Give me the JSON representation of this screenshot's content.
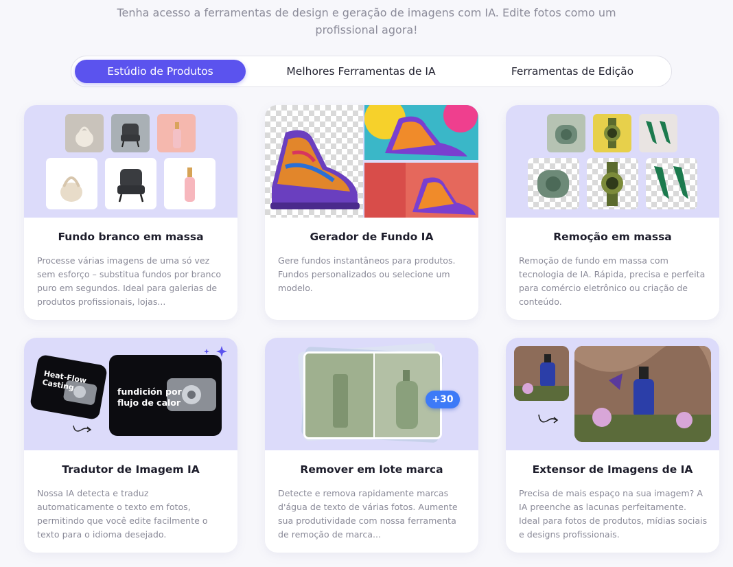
{
  "intro": {
    "line1": "Tenha acesso a ferramentas de design e geração de imagens com IA. Edite fotos como um",
    "line2": "profissional agora!"
  },
  "tabs": [
    {
      "label": "Estúdio de Produtos",
      "active": true
    },
    {
      "label": "Melhores Ferramentas de IA",
      "active": false
    },
    {
      "label": "Ferramentas de Edição",
      "active": false
    }
  ],
  "cards": [
    {
      "title": "Fundo branco em massa",
      "description": "Processe várias imagens de uma só vez sem esforço – substitua fundos por branco puro em segundos. Ideal para galerias de produtos profissionais, lojas..."
    },
    {
      "title": "Gerador de Fundo IA",
      "description": "Gere fundos instantâneos para produtos. Fundos personalizados ou selecione um modelo."
    },
    {
      "title": "Remoção em massa",
      "description": "Remoção de fundo em massa com tecnologia de IA. Rápida, precisa e perfeita para comércio eletrônico ou criação de conteúdo."
    },
    {
      "title": "Tradutor de Imagem IA",
      "description": "Nossa IA detecta e traduz automaticamente o texto em fotos, permitindo que você edite facilmente o texto para o idioma desejado.",
      "image_text_before": "Heat-Flow Casting",
      "image_text_after": "fundición por flujo de calor"
    },
    {
      "title": "Remover em lote marca",
      "description": "Detecte e remova rapidamente marcas d'água de texto de várias fotos. Aumente sua produtividade com nossa ferramenta de remoção de marca...",
      "badge": "+30"
    },
    {
      "title": "Extensor de Imagens de IA",
      "description": "Precisa de mais espaço na sua imagem? A IA preenche as lacunas perfeitamente. Ideal para fotos de produtos, mídias sociais e designs profissionais."
    }
  ],
  "colors": {
    "accent": "#5b53ee",
    "thumb_background": "#dcdbfa",
    "badge": "#3d7af7"
  }
}
